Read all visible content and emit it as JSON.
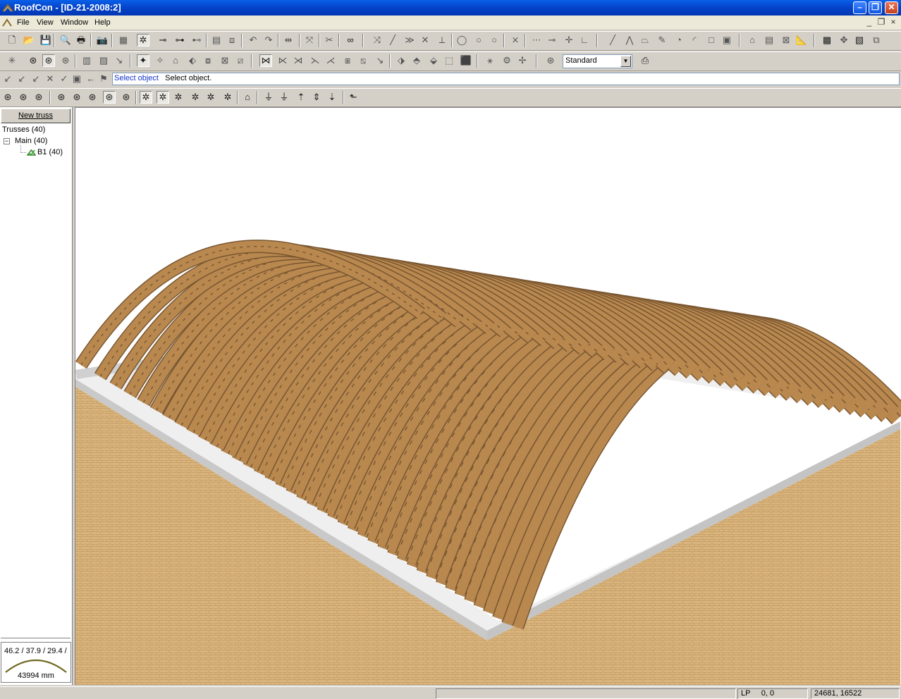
{
  "window": {
    "title": "RoofCon - [ID-21-2008:2]"
  },
  "menu": {
    "items": [
      "File",
      "View",
      "Window",
      "Help"
    ]
  },
  "toolbar3": {
    "select_value": "Standard"
  },
  "command": {
    "prompt": "Select object",
    "message": "Select object."
  },
  "left_panel": {
    "new_truss_label": "New truss",
    "tree": {
      "root": "Trusses (40)",
      "group": "Main (40)",
      "leaf": "B1 (40)"
    },
    "preview": {
      "angles": "46.2 / 37.9 / 29.4 /",
      "span": "43994 mm"
    }
  },
  "status": {
    "mode": "LP",
    "values": "0,  0",
    "coords": "24681, 16522"
  },
  "colors": {
    "timber": "#b8884f",
    "timber_dark": "#7a5630",
    "brick": "#d9b47c",
    "slab": "#cfcfcf"
  }
}
